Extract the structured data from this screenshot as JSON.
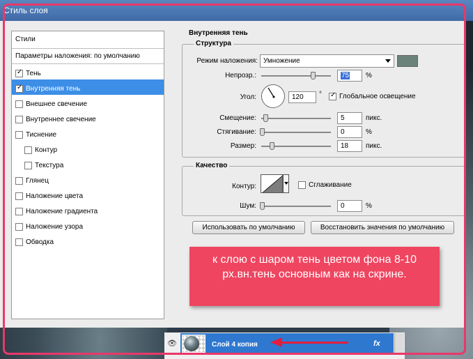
{
  "window": {
    "title": "Стиль слоя"
  },
  "styles_panel": {
    "header": "Стили",
    "default_item": "Параметры наложения: по умолчанию",
    "items": [
      {
        "label": "Тень",
        "checked": true,
        "indent": false,
        "selected": false
      },
      {
        "label": "Внутренняя тень",
        "checked": true,
        "indent": false,
        "selected": true
      },
      {
        "label": "Внешнее свечение",
        "checked": false,
        "indent": false,
        "selected": false
      },
      {
        "label": "Внутреннее свечение",
        "checked": false,
        "indent": false,
        "selected": false
      },
      {
        "label": "Тиснение",
        "checked": false,
        "indent": false,
        "selected": false
      },
      {
        "label": "Контур",
        "checked": false,
        "indent": true,
        "selected": false
      },
      {
        "label": "Текстура",
        "checked": false,
        "indent": true,
        "selected": false
      },
      {
        "label": "Глянец",
        "checked": false,
        "indent": false,
        "selected": false
      },
      {
        "label": "Наложение цвета",
        "checked": false,
        "indent": false,
        "selected": false
      },
      {
        "label": "Наложение градиента",
        "checked": false,
        "indent": false,
        "selected": false
      },
      {
        "label": "Наложение узора",
        "checked": false,
        "indent": false,
        "selected": false
      },
      {
        "label": "Обводка",
        "checked": false,
        "indent": false,
        "selected": false
      }
    ]
  },
  "inner_shadow": {
    "section_title": "Внутренняя тень",
    "structure": {
      "group_label": "Структура",
      "blend_mode_label": "Режим наложения:",
      "blend_mode_value": "Умножение",
      "color_swatch": "#6a827a",
      "opacity_label": "Непрозр.:",
      "opacity_value": "75",
      "opacity_unit": "%",
      "opacity_level": 0.75,
      "angle_label": "Угол:",
      "angle_value": "120",
      "angle_unit": "°",
      "global_light_label": "Глобальное освещение",
      "global_light_checked": true,
      "distance_label": "Смещение:",
      "distance_value": "5",
      "distance_unit": "пикс.",
      "choke_label": "Стягивание:",
      "choke_value": "0",
      "choke_unit": "%",
      "size_label": "Размер:",
      "size_value": "18",
      "size_unit": "пикс."
    },
    "quality": {
      "group_label": "Качество",
      "contour_label": "Контур:",
      "antialias_label": "Сглаживание",
      "antialias_checked": false,
      "noise_label": "Шум:",
      "noise_value": "0",
      "noise_unit": "%"
    },
    "buttons": {
      "make_default": "Использовать по умолчанию",
      "reset_default": "Восстановить значения по умолчанию"
    }
  },
  "annotation": {
    "text": "к слою с шаром тень цветом фона 8-10 рх.вн.тень основным как на скрине."
  },
  "layers": {
    "active_layer_name": "Слой 4 копия",
    "fx_label": "fx"
  },
  "colors": {
    "selection_blue": "#3d8ee6",
    "annotation_red": "#ef4560",
    "frame_pink": "#e8386a"
  }
}
